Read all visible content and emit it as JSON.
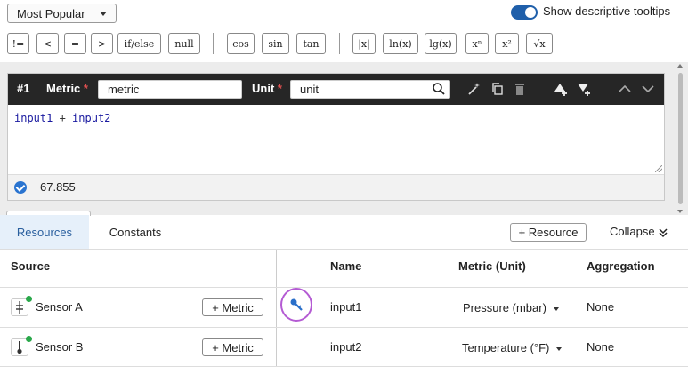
{
  "toolbar": {
    "sort_select": "Most Popular",
    "tooltips_label": "Show descriptive tooltips",
    "tooltips_on": true,
    "operators": [
      "!=",
      "<",
      "=",
      ">",
      "if/else",
      "null"
    ],
    "trig": [
      "cos",
      "sin",
      "tan"
    ],
    "funcs": [
      "|x|",
      "ln(x)",
      "lg(x)",
      "xⁿ",
      "x²",
      "√x"
    ]
  },
  "editor": {
    "index": "#1",
    "metric_label": "Metric",
    "required_mark": "*",
    "metric_value": "metric",
    "unit_label": "Unit",
    "unit_value": "unit",
    "formula_a": "input1",
    "formula_op": " + ",
    "formula_b": "input2",
    "result": "67.855"
  },
  "tabs": {
    "resources": "Resources",
    "constants": "Constants"
  },
  "actions": {
    "add_resource": "+ Resource",
    "collapse": "Collapse"
  },
  "table": {
    "headers": {
      "source": "Source",
      "name": "Name",
      "metric": "Metric (Unit)",
      "aggregation": "Aggregation"
    },
    "rows": [
      {
        "source": "Sensor A",
        "metric_button": "+ Metric",
        "name": "input1",
        "metric": "Pressure (mbar)",
        "aggregation": "None",
        "icon": "pressure-icon"
      },
      {
        "source": "Sensor B",
        "metric_button": "+ Metric",
        "name": "input2",
        "metric": "Temperature (°F)",
        "aggregation": "None",
        "icon": "thermometer-icon"
      }
    ]
  },
  "colors": {
    "accent": "#1f5faa",
    "header_bg": "#262626",
    "status_ok": "#2aa84a",
    "highlight_ring": "#b45bd3"
  }
}
